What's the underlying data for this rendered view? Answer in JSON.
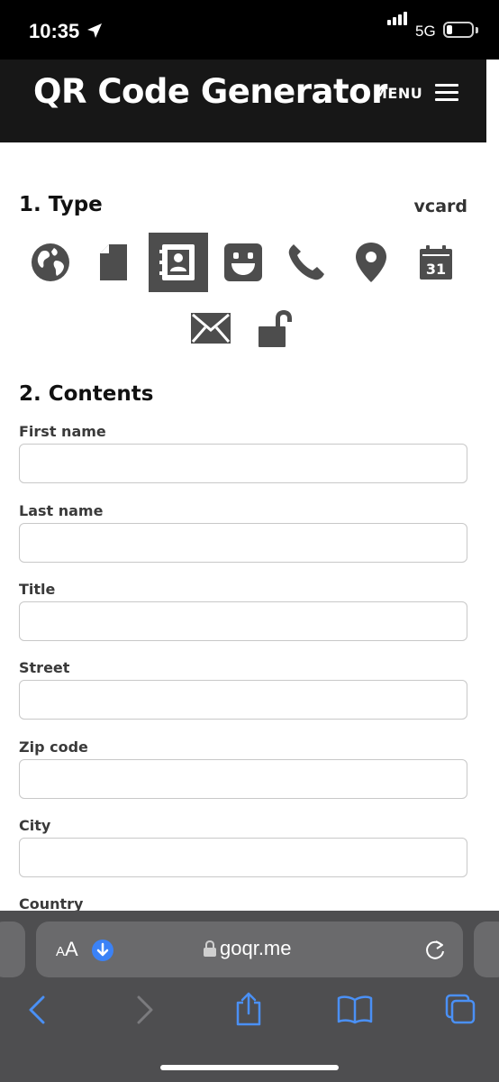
{
  "status_bar": {
    "time": "10:35",
    "network": "5G"
  },
  "header": {
    "title": "QR Code Generator",
    "menu_label": "MENU"
  },
  "type_section": {
    "heading": "1. Type",
    "selected_value": "vcard",
    "options": [
      {
        "icon": "globe-icon",
        "active": false
      },
      {
        "icon": "document-icon",
        "active": false
      },
      {
        "icon": "contact-card-icon",
        "active": true
      },
      {
        "icon": "smiley-icon",
        "active": false
      },
      {
        "icon": "phone-icon",
        "active": false
      },
      {
        "icon": "map-pin-icon",
        "active": false
      },
      {
        "icon": "calendar-icon",
        "active": false,
        "text": "31"
      },
      {
        "icon": "envelope-icon",
        "active": false
      },
      {
        "icon": "unlock-icon",
        "active": false
      }
    ]
  },
  "contents_section": {
    "heading": "2. Contents",
    "fields": [
      {
        "label": "First name",
        "value": ""
      },
      {
        "label": "Last name",
        "value": ""
      },
      {
        "label": "Title",
        "value": ""
      },
      {
        "label": "Street",
        "value": ""
      },
      {
        "label": "Zip code",
        "value": ""
      },
      {
        "label": "City",
        "value": ""
      },
      {
        "label": "Country",
        "value": ""
      }
    ]
  },
  "browser": {
    "aa_small": "A",
    "aa_large": "A",
    "url": "goqr.me"
  },
  "colors": {
    "header_bg": "#171717",
    "active_icon_bg": "#4d4d4d",
    "icon_color": "#4d4d4d",
    "browser_bg": "#4e4e50",
    "accent_blue": "#3b82f6"
  }
}
